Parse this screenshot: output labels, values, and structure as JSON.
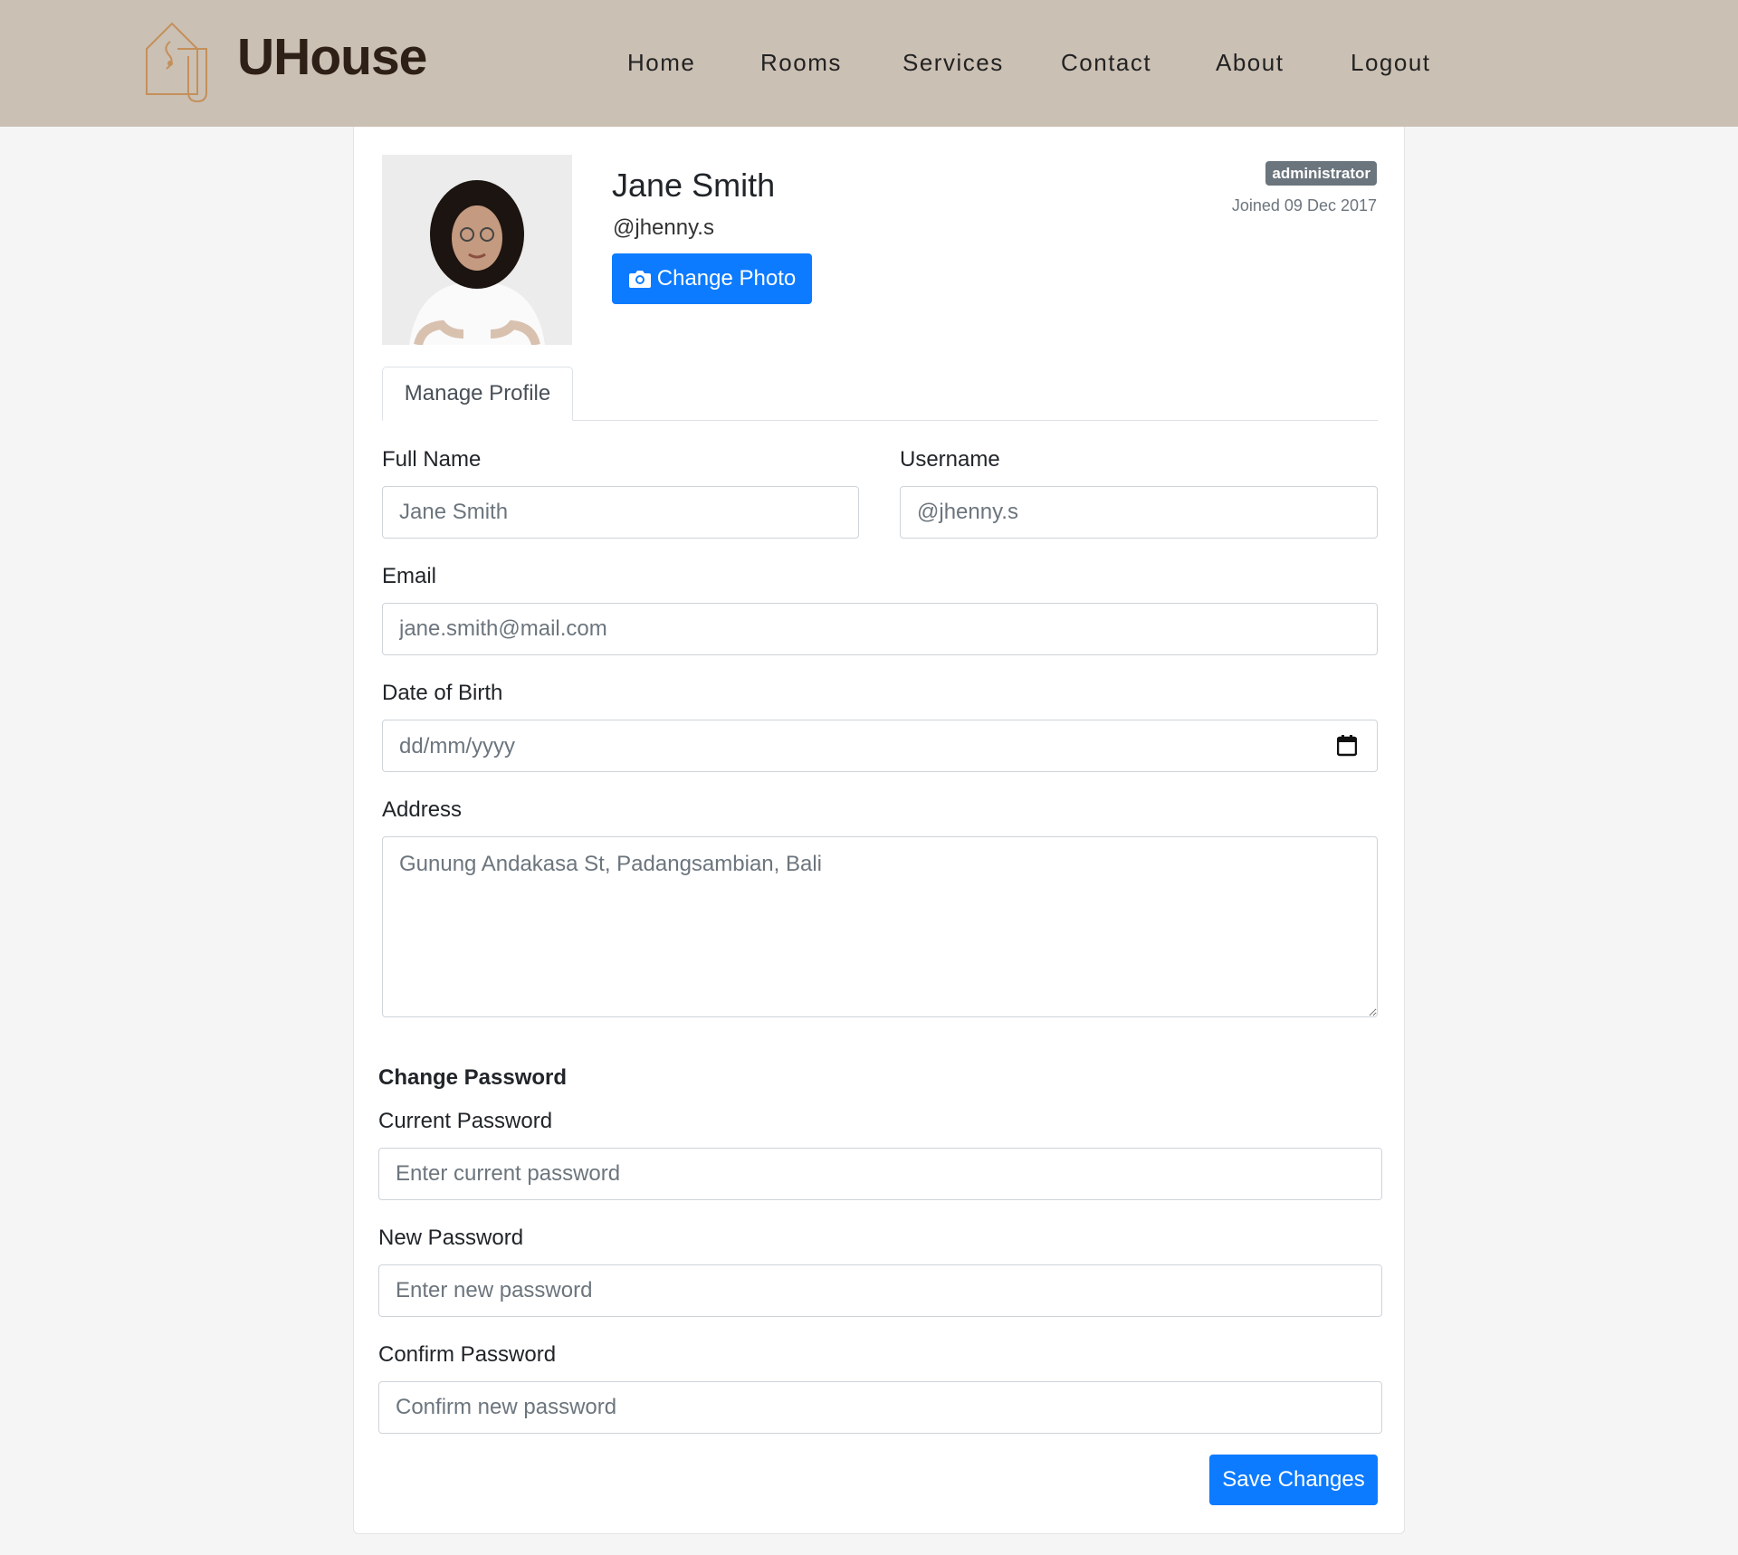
{
  "brand": {
    "name": "UHouse"
  },
  "nav": [
    "Home",
    "Rooms",
    "Services",
    "Contact",
    "About",
    "Logout"
  ],
  "profile": {
    "name": "Jane Smith",
    "handle": "@jhenny.s",
    "change_photo_label": "Change Photo",
    "role_badge": "administrator",
    "joined": "Joined 09 Dec 2017"
  },
  "tabs": {
    "manage_profile": "Manage Profile"
  },
  "form": {
    "full_name": {
      "label": "Full Name",
      "value": "Jane Smith"
    },
    "username": {
      "label": "Username",
      "value": "@jhenny.s"
    },
    "email": {
      "label": "Email",
      "value": "jane.smith@mail.com"
    },
    "dob": {
      "label": "Date of Birth",
      "placeholder": "dd/mm/yyyy"
    },
    "address": {
      "label": "Address",
      "value": "Gunung Andakasa St, Padangsambian, Bali"
    }
  },
  "password": {
    "title": "Change Password",
    "current": {
      "label": "Current Password",
      "placeholder": "Enter current password"
    },
    "new": {
      "label": "New Password",
      "placeholder": "Enter new password"
    },
    "confirm": {
      "label": "Confirm Password",
      "placeholder": "Confirm new password"
    }
  },
  "actions": {
    "save_label": "Save Changes"
  },
  "colors": {
    "header_bg": "#cbc0b4",
    "primary": "#0d7bff",
    "badge_bg": "#6b757d"
  }
}
